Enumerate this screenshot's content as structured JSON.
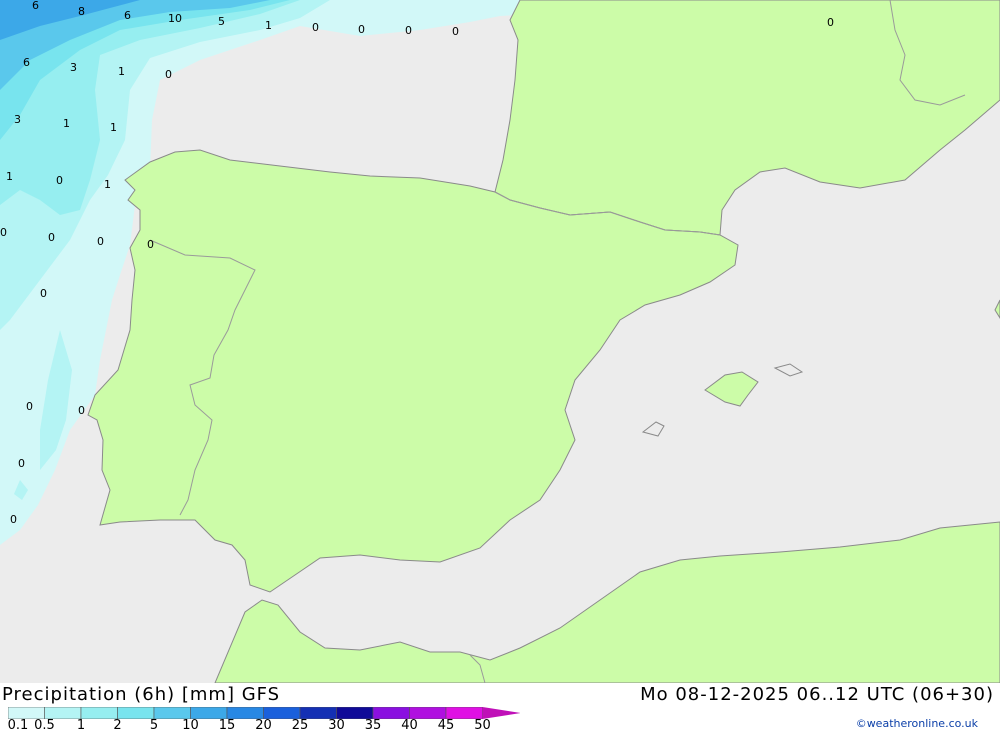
{
  "title": "Precipitation (6h) [mm] GFS",
  "datetime": "Mo 08-12-2025 06..12 UTC (06+30)",
  "credit": "©weatheronline.co.uk",
  "colors": {
    "sea": "#ececec",
    "land": "#ccfca8",
    "border": "#9a9a9a",
    "coast": "#7a7a7a"
  },
  "legend": {
    "labels": [
      "0.1",
      "0.5",
      "1",
      "2",
      "5",
      "10",
      "15",
      "20",
      "25",
      "30",
      "35",
      "40",
      "45",
      "50"
    ],
    "colors": [
      "#d2f8f8",
      "#b4f4f4",
      "#96eef0",
      "#78e4ee",
      "#5ac8ec",
      "#3ca8e8",
      "#2888e4",
      "#1a60dc",
      "#1430b4",
      "#100a98",
      "#8a10e0",
      "#b010e0",
      "#e010e4",
      "#c010b8"
    ]
  },
  "contour_values": [
    "6",
    "8",
    "6",
    "10",
    "5",
    "1",
    "0",
    "0",
    "0",
    "0",
    "0",
    "6",
    "3",
    "1",
    "0",
    "3",
    "1",
    "1",
    "1",
    "0",
    "1",
    "0",
    "0",
    "0",
    "0",
    "0",
    "0",
    "0",
    "0",
    "0",
    "0"
  ]
}
